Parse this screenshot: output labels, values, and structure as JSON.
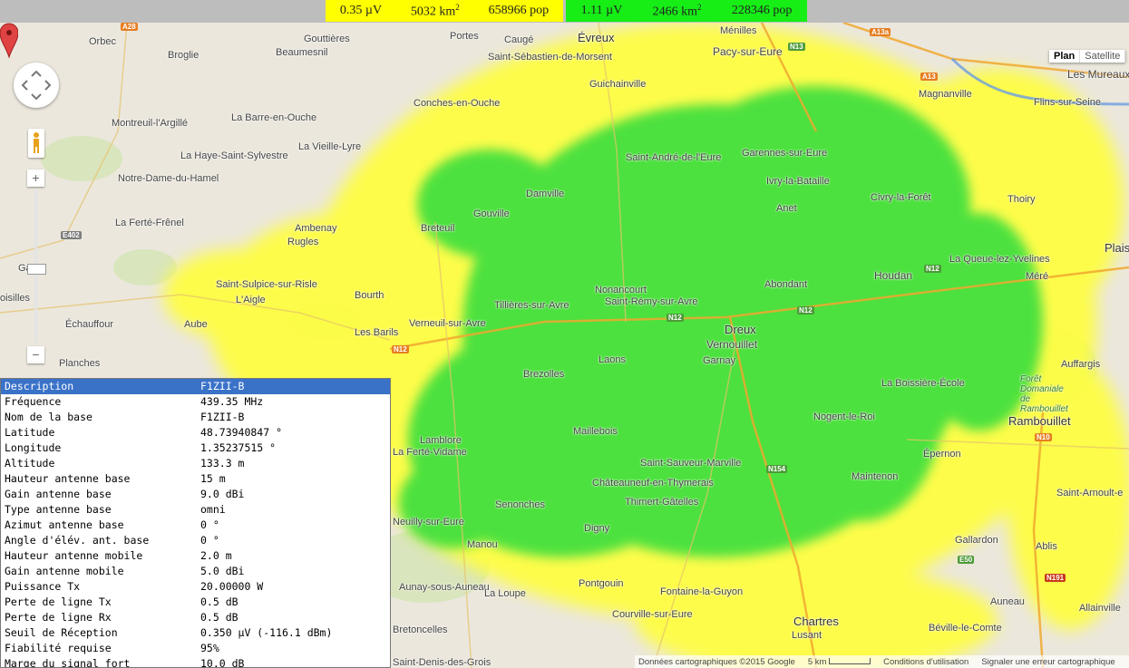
{
  "legend": [
    {
      "field": "0.35 µV",
      "area_num": "5032 km",
      "area_exp": "2",
      "pop": "658966 pop",
      "color": "#ffff00"
    },
    {
      "field": "1.11 µV",
      "area_num": "2466 km",
      "area_exp": "2",
      "pop": "228346 pop",
      "color": "#16ee16"
    }
  ],
  "map_controls": {
    "zoom_in": "+",
    "zoom_out": "−",
    "map_types": [
      "Plan",
      "Satellite"
    ],
    "active_type": "Plan"
  },
  "towns": [
    "Orbec",
    "Gouttières",
    "Broglie",
    "Beaumesnil",
    "Portes",
    "Caugé",
    "Évreux",
    "Saint-Sébastien-de-Morsent",
    "Ménilles",
    "Pacy-sur-Eure",
    "Les Mureaux",
    "Magnanville",
    "Flins-sur-Seine",
    "Guichainville",
    "Conches-en-Ouche",
    "Montreuil-l'Argillé",
    "La Barre-en-Ouche",
    "La Vieille-Lyre",
    "La Haye-Saint-Sylvestre",
    "Saint-André-de-l'Eure",
    "Garennes-sur-Eure",
    "Notre-Dame-du-Hamel",
    "Damville",
    "Ivry-la-Bataille",
    "Civry-la-Forêt",
    "Thoiry",
    "La Ferté-Frênel",
    "Gouville",
    "Anet",
    "Ambenay",
    "Breteuil",
    "Rugles",
    "Plais",
    "La Queue-lez-Yvelines",
    "Gacé",
    "Houdan",
    "Méré",
    "Saint-Sulpice-sur-Risle",
    "Abondant",
    "Nonancourt",
    "L'Aigle",
    "Bourth",
    "Tillières-sur-Avre",
    "Saint-Rémy-sur-Avre",
    "oisilles",
    "Échauffour",
    "Aube",
    "Verneuil-sur-Avre",
    "Dreux",
    "Les Barils",
    "Vernouillet",
    "Planches",
    "Laons",
    "Garnay",
    "Auffargis",
    "Brezolles",
    "La Boissière-École",
    "Forêt Domaniale de Rambouillet",
    "Nogent-le-Roi",
    "Rambouillet",
    "Maillebois",
    "Lamblore",
    "La Ferté-Vidame",
    "Épernon",
    "Saint-Sauveur-Marville",
    "Maintenon",
    "Châteauneuf-en-Thymerais",
    "Senonches",
    "Thimert-Gâtelles",
    "Saint-Arnoult-e",
    "Neuilly-sur-Eure",
    "Digny",
    "Manou",
    "Gallardon",
    "Ablis",
    "Pontgouin",
    "Fontaine-la-Guyon",
    "Aunay-sous-Auneau",
    "Auneau",
    "Allainville",
    "La Loupe",
    "Courville-sur-Eure",
    "Chartres",
    "Bretoncelles",
    "Lusant",
    "Béville-le-Comte",
    "Saint-Denis-des-Grois"
  ],
  "roads": [
    "A28",
    "N13",
    "A13a",
    "A13",
    "E402",
    "N12",
    "N12",
    "N12",
    "N12",
    "N10",
    "N154",
    "E50",
    "N191"
  ],
  "footer": {
    "map_data": "Données cartographiques ©2015 Google",
    "scale": "5 km",
    "terms": "Conditions d'utilisation",
    "report": "Signaler une erreur cartographique"
  },
  "info": {
    "header": {
      "label": "Description",
      "value": "F1ZII-B"
    },
    "rows": [
      {
        "label": "Fréquence",
        "value": "439.35 MHz"
      },
      {
        "label": "Nom de la base",
        "value": "F1ZII-B"
      },
      {
        "label": "Latitude",
        "value": "48.73940847 °"
      },
      {
        "label": "Longitude",
        "value": "1.35237515 °"
      },
      {
        "label": "Altitude",
        "value": "133.3 m"
      },
      {
        "label": "Hauteur antenne base",
        "value": "15 m"
      },
      {
        "label": "Gain antenne base",
        "value": "9.0 dBi"
      },
      {
        "label": "Type antenne base",
        "value": "omni"
      },
      {
        "label": "Azimut antenne base",
        "value": "0 °"
      },
      {
        "label": "Angle d'élév. ant. base",
        "value": "0 °"
      },
      {
        "label": "Hauteur antenne mobile",
        "value": "2.0 m"
      },
      {
        "label": "Gain antenne mobile",
        "value": "5.0 dBi"
      },
      {
        "label": "Puissance Tx",
        "value": "20.00000 W"
      },
      {
        "label": "Perte de ligne Tx",
        "value": "0.5 dB"
      },
      {
        "label": "Perte de ligne Rx",
        "value": "0.5 dB"
      },
      {
        "label": "Seuil de Réception",
        "value": "0.350 µV (-116.1 dBm)"
      },
      {
        "label": "Fiabilité requise",
        "value": "95%"
      },
      {
        "label": "Marge du signal fort",
        "value": "10.0 dB"
      }
    ]
  }
}
